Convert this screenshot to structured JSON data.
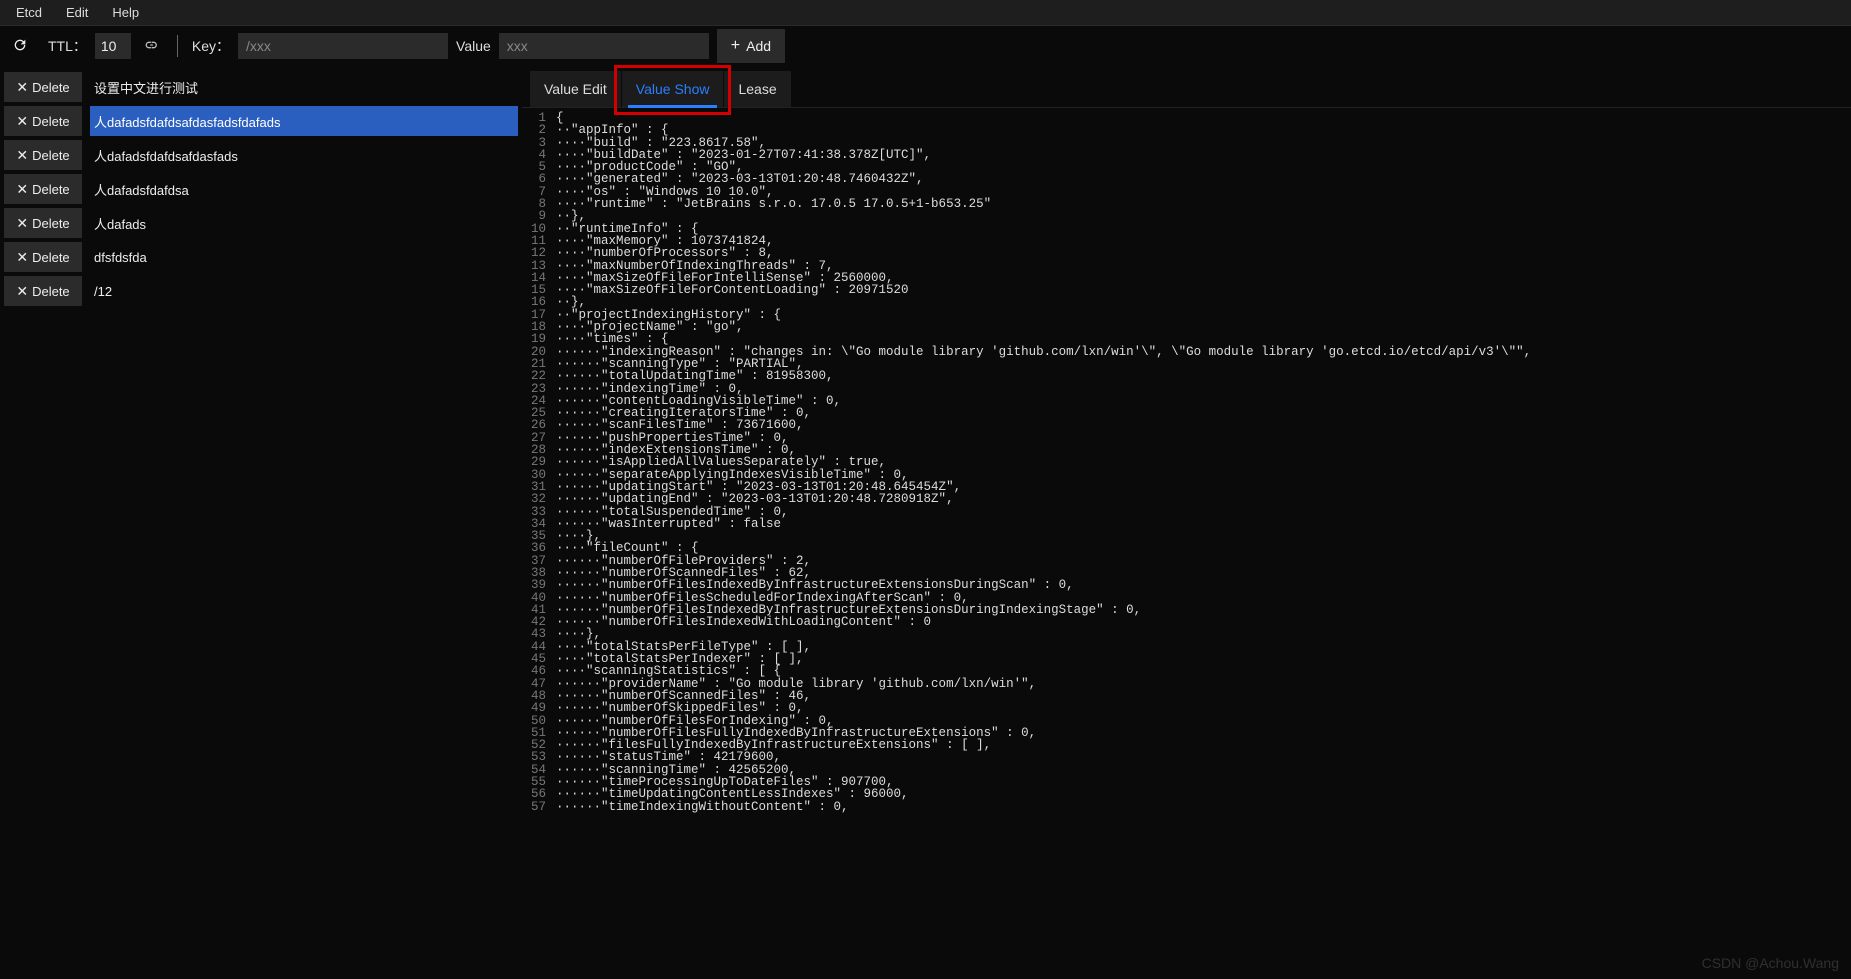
{
  "menubar": {
    "items": [
      "Etcd",
      "Edit",
      "Help"
    ]
  },
  "toolbar": {
    "ttl_label": "TTL：",
    "ttl_value": "10",
    "key_label": "Key：",
    "key_placeholder": "/xxx",
    "value_label": "Value",
    "value_placeholder": "xxx",
    "add_label": "Add"
  },
  "sidebar": {
    "delete_label": "Delete",
    "items": [
      {
        "key": "设置中文进行测试",
        "selected": false
      },
      {
        "key": "人dafadsfdafdsafdasfadsfdafads",
        "selected": true
      },
      {
        "key": "人dafadsfdafdsafdasfads",
        "selected": false
      },
      {
        "key": "人dafadsfdafdsa",
        "selected": false
      },
      {
        "key": "人dafads",
        "selected": false
      },
      {
        "key": "dfsfdsfda",
        "selected": false
      },
      {
        "key": "/12",
        "selected": false
      }
    ]
  },
  "tabs": {
    "items": [
      {
        "label": "Value Edit",
        "active": false
      },
      {
        "label": "Value Show",
        "active": true
      },
      {
        "label": "Lease",
        "active": false
      }
    ],
    "highlight_index": 1
  },
  "code": {
    "lines": [
      "{",
      "  \"appInfo\" : {",
      "    \"build\" : \"223.8617.58\",",
      "    \"buildDate\" : \"2023-01-27T07:41:38.378Z[UTC]\",",
      "    \"productCode\" : \"GO\",",
      "    \"generated\" : \"2023-03-13T01:20:48.7460432Z\",",
      "    \"os\" : \"Windows 10 10.0\",",
      "    \"runtime\" : \"JetBrains s.r.o. 17.0.5 17.0.5+1-b653.25\"",
      "  },",
      "  \"runtimeInfo\" : {",
      "    \"maxMemory\" : 1073741824,",
      "    \"numberOfProcessors\" : 8,",
      "    \"maxNumberOfIndexingThreads\" : 7,",
      "    \"maxSizeOfFileForIntelliSense\" : 2560000,",
      "    \"maxSizeOfFileForContentLoading\" : 20971520",
      "  },",
      "  \"projectIndexingHistory\" : {",
      "    \"projectName\" : \"go\",",
      "    \"times\" : {",
      "      \"indexingReason\" : \"changes in: \\\"Go module library 'github.com/lxn/win'\\\", \\\"Go module library 'go.etcd.io/etcd/api/v3'\\\"\",",
      "      \"scanningType\" : \"PARTIAL\",",
      "      \"totalUpdatingTime\" : 81958300,",
      "      \"indexingTime\" : 0,",
      "      \"contentLoadingVisibleTime\" : 0,",
      "      \"creatingIteratorsTime\" : 0,",
      "      \"scanFilesTime\" : 73671600,",
      "      \"pushPropertiesTime\" : 0,",
      "      \"indexExtensionsTime\" : 0,",
      "      \"isAppliedAllValuesSeparately\" : true,",
      "      \"separateApplyingIndexesVisibleTime\" : 0,",
      "      \"updatingStart\" : \"2023-03-13T01:20:48.645454Z\",",
      "      \"updatingEnd\" : \"2023-03-13T01:20:48.7280918Z\",",
      "      \"totalSuspendedTime\" : 0,",
      "      \"wasInterrupted\" : false",
      "    },",
      "    \"fileCount\" : {",
      "      \"numberOfFileProviders\" : 2,",
      "      \"numberOfScannedFiles\" : 62,",
      "      \"numberOfFilesIndexedByInfrastructureExtensionsDuringScan\" : 0,",
      "      \"numberOfFilesScheduledForIndexingAfterScan\" : 0,",
      "      \"numberOfFilesIndexedByInfrastructureExtensionsDuringIndexingStage\" : 0,",
      "      \"numberOfFilesIndexedWithLoadingContent\" : 0",
      "    },",
      "    \"totalStatsPerFileType\" : [ ],",
      "    \"totalStatsPerIndexer\" : [ ],",
      "    \"scanningStatistics\" : [ {",
      "      \"providerName\" : \"Go module library 'github.com/lxn/win'\",",
      "      \"numberOfScannedFiles\" : 46,",
      "      \"numberOfSkippedFiles\" : 0,",
      "      \"numberOfFilesForIndexing\" : 0,",
      "      \"numberOfFilesFullyIndexedByInfrastructureExtensions\" : 0,",
      "      \"filesFullyIndexedByInfrastructureExtensions\" : [ ],",
      "      \"statusTime\" : 42179600,",
      "      \"scanningTime\" : 42565200,",
      "      \"timeProcessingUpToDateFiles\" : 907700,",
      "      \"timeUpdatingContentLessIndexes\" : 96000,",
      "      \"timeIndexingWithoutContent\" : 0,"
    ]
  },
  "watermark": "CSDN @Achou.Wang"
}
